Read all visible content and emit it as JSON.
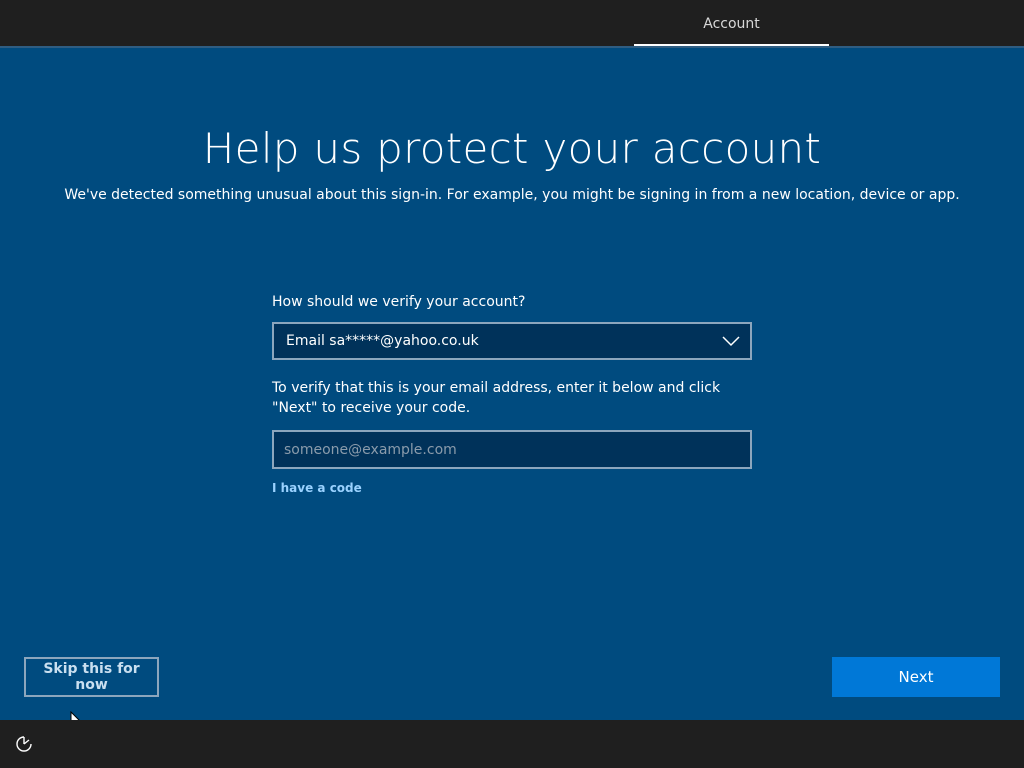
{
  "header": {
    "tab_label": "Account"
  },
  "main": {
    "title": "Help us protect your account",
    "subtitle": "We've detected something unusual about this sign-in. For example, you might be signing in from a new location, device or app."
  },
  "form": {
    "verify_label": "How should we verify your account?",
    "verify_method_selected": "Email sa*****@yahoo.co.uk",
    "instruction": "To verify that this is your email address, enter it below and click \"Next\" to receive your code.",
    "email_input": {
      "value": "",
      "placeholder": "someone@example.com"
    },
    "code_link": "I have a code"
  },
  "footer": {
    "skip_label": "Skip this for now",
    "next_label": "Next",
    "ease_of_access_icon": "ease-of-access-icon"
  },
  "colors": {
    "background": "#004b7f",
    "bar": "#1f1f1f",
    "accent": "#0078d7",
    "link": "#9ad2ff"
  }
}
